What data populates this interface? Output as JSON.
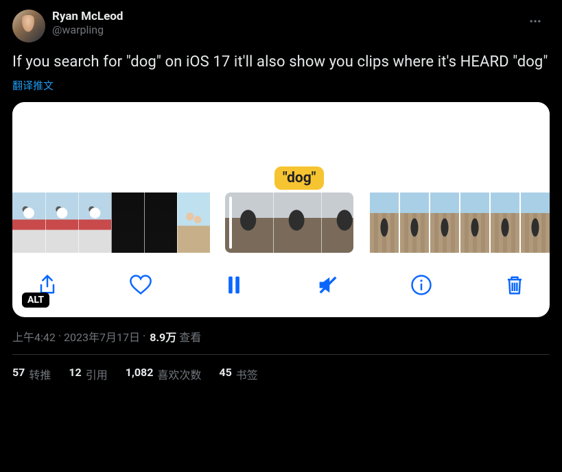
{
  "author": {
    "display_name": "Ryan McLeod",
    "handle": "@warpling"
  },
  "tweet_text": "If you search for \"dog\" on iOS 17 it'll also show you clips where it's HEARD \"dog\"",
  "translate_label": "翻译推文",
  "media": {
    "search_token": "\"dog\"",
    "alt_badge": "ALT"
  },
  "toolbar_icons": {
    "share": "share-icon",
    "like": "heart-icon",
    "pause": "pause-icon",
    "mute": "mute-icon",
    "info": "info-icon",
    "delete": "trash-icon"
  },
  "meta": {
    "time": "上午4:42",
    "dot": " · ",
    "date": "2023年7月17日",
    "views_number": "8.9万",
    "views_label": "查看"
  },
  "stats": {
    "retweets": {
      "count": "57",
      "label": "转推"
    },
    "quotes": {
      "count": "12",
      "label": "引用"
    },
    "likes": {
      "count": "1,082",
      "label": "喜欢次数"
    },
    "bookmarks": {
      "count": "45",
      "label": "书签"
    }
  }
}
